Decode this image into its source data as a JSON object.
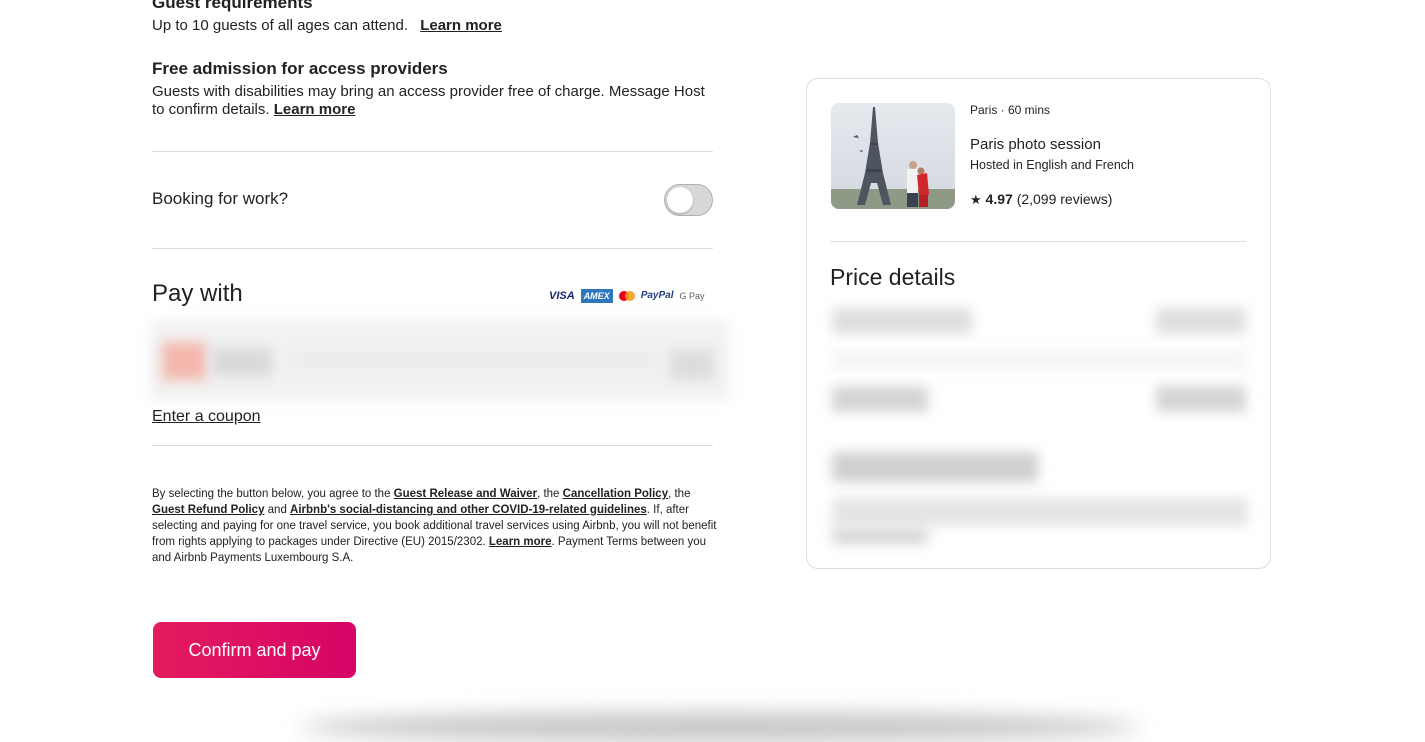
{
  "guest": {
    "heading": "Guest requirements",
    "text": "Up to 10 guests of all ages can attend.",
    "link": "Learn more"
  },
  "access": {
    "heading": "Free admission for access providers",
    "text": "Guests with disabilities may bring an access provider free of charge. Message Host to confirm details.",
    "link": "Learn more"
  },
  "work": {
    "label": "Booking for work?",
    "toggle_on": false
  },
  "pay": {
    "title": "Pay with",
    "cards": [
      "VISA",
      "AMEX",
      "mastercard-icon",
      "PayPal",
      "G Pay"
    ],
    "coupon": "Enter a coupon"
  },
  "legal": {
    "t1": "By selecting the button below, you agree to the ",
    "l1": "Guest Release and Waiver",
    "t2": ", the ",
    "l2": "Cancellation Policy",
    "t3": ", the ",
    "l3": "Guest Refund Policy",
    "t4": " and ",
    "l4": "Airbnb's social-distancing and other COVID-19-related guidelines",
    "t5": ". If, after selecting and paying for one travel service, you book additional travel services using Airbnb, you will not benefit from rights applying to packages under Directive (EU) 2015/2302. ",
    "l5": "Learn more",
    "t6": ". Payment Terms between you and Airbnb Payments Luxembourg S.A."
  },
  "confirm_label": "Confirm and pay",
  "listing": {
    "meta": "Paris · 60 mins",
    "title": "Paris photo session",
    "hosted": "Hosted in English and French",
    "rating": "4.97",
    "reviews": "(2,099 reviews)"
  },
  "price": {
    "title": "Price details"
  },
  "colors": {
    "accent": "#e31c5f",
    "text": "#222222",
    "divider": "#dddddd"
  }
}
